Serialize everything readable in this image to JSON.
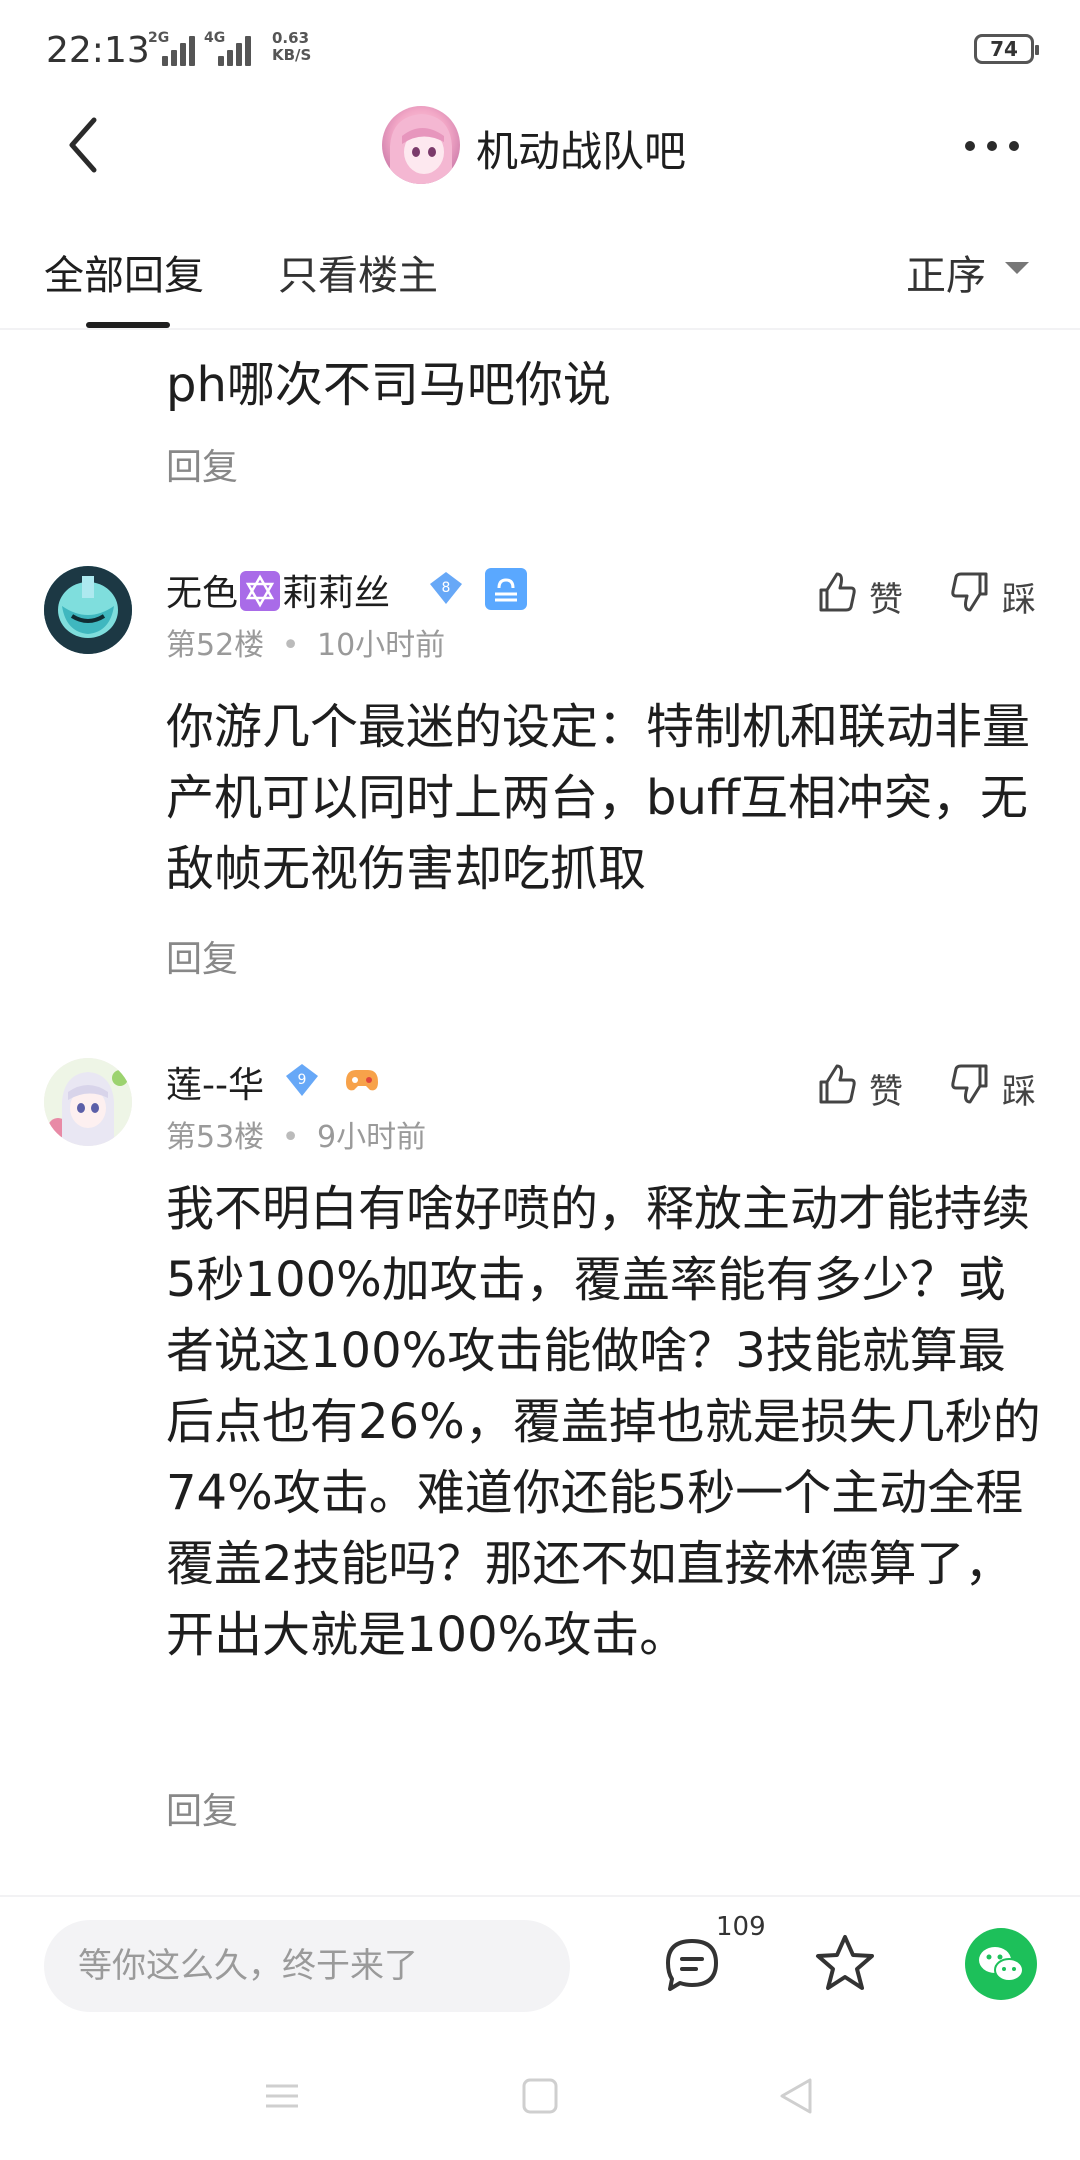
{
  "status_bar": {
    "time": "22:13",
    "signal1": "2G",
    "signal2": "4G",
    "net_speed_value": "0.63",
    "net_speed_unit": "KB/S",
    "battery": "74"
  },
  "header": {
    "title": "机动战队吧",
    "back_icon": "chevron-left-icon",
    "more_icon": "more-dots-icon"
  },
  "tabs": {
    "all_replies": "全部回复",
    "owner_only": "只看楼主",
    "sort": "正序"
  },
  "posts": [
    {
      "content": "ph哪次不司马吧你说",
      "reply_label": "回复"
    },
    {
      "username_prefix": "无色",
      "username_suffix": "莉莉丝",
      "level": "8",
      "floor": "第52楼",
      "time": "10小时前",
      "content": "你游几个最迷的设定：特制机和联动非量产机可以同时上两台，buff互相冲突，无敌帧无视伤害却吃抓取",
      "like_label": "赞",
      "dislike_label": "踩",
      "reply_label": "回复"
    },
    {
      "username": "莲--华",
      "level": "9",
      "floor": "第53楼",
      "time": "9小时前",
      "content": "我不明白有啥好喷的，释放主动才能持续5秒100%加攻击，覆盖率能有多少？或者说这100%攻击能做啥？3技能就算最后点也有26%，覆盖掉也就是损失几秒的74%攻击。难道你还能5秒一个主动全程覆盖2技能吗？那还不如直接林德算了，开出大就是100%攻击。",
      "like_label": "赞",
      "dislike_label": "踩",
      "reply_label": "回复"
    }
  ],
  "bottom_bar": {
    "input_placeholder": "等你这么久，终于来了",
    "comment_count": "109"
  },
  "colors": {
    "accent_green": "#1dc05a",
    "badge_blue": "#5aa8ff",
    "text_primary": "#1e1e1e",
    "text_secondary": "#9a9a9a"
  }
}
